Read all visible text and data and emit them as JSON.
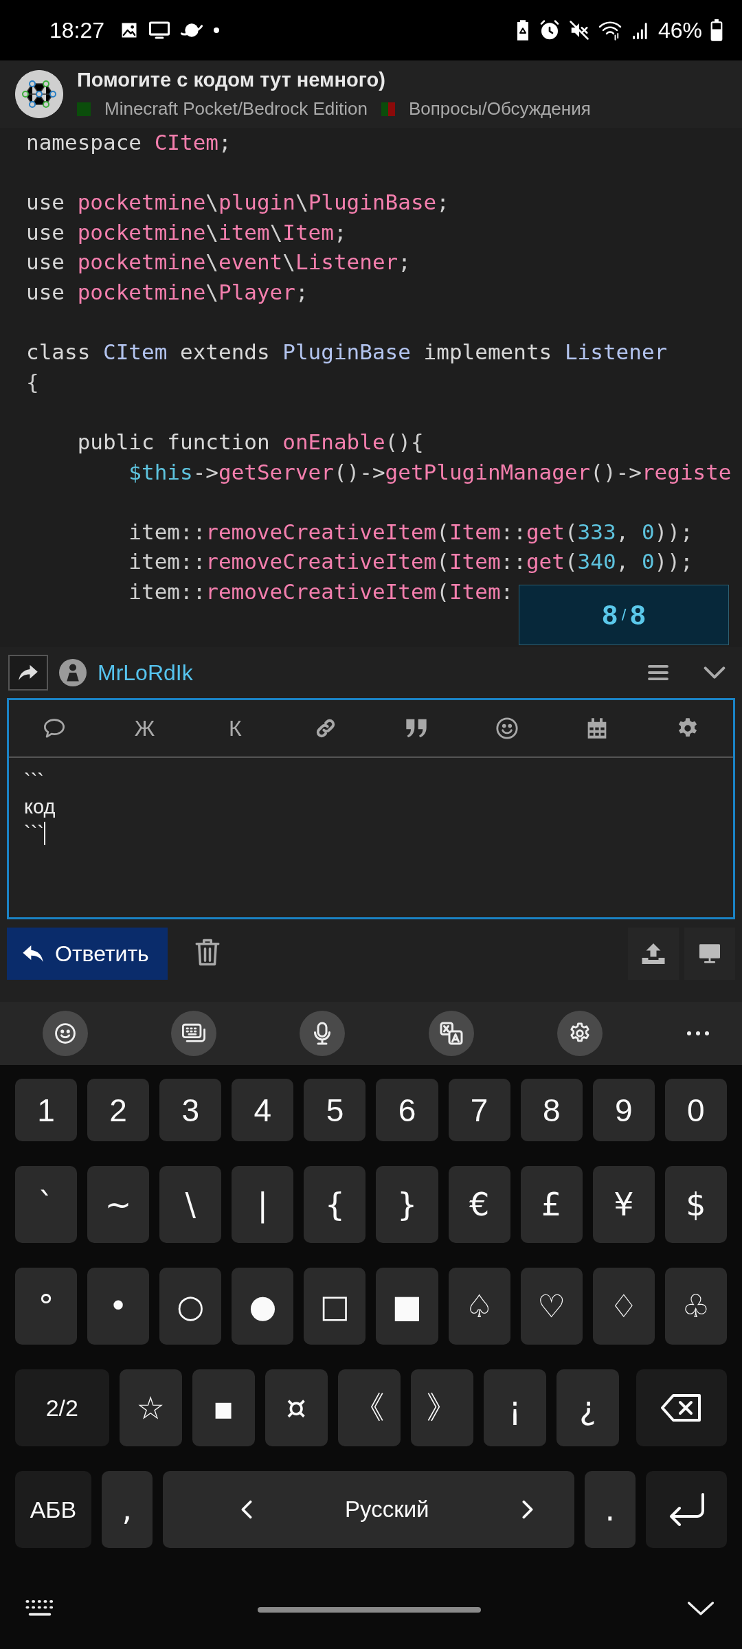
{
  "status_bar": {
    "time": "18:27",
    "battery": "46%"
  },
  "thread": {
    "title": "Помогите с кодом тут немного)",
    "tags": [
      {
        "label": "Minecraft Pocket/Bedrock Edition",
        "swatch": [
          {
            "color": "#0b4d0b"
          }
        ]
      },
      {
        "label": "Вопросы/Обсуждения",
        "swatch": [
          {
            "color": "#0b4d0b"
          },
          {
            "color": "#8b0a0a"
          }
        ]
      }
    ]
  },
  "code": {
    "blocks": [
      [
        [
          {
            "t": "namespace ",
            "kind": "kw"
          },
          {
            "t": "CItem",
            "kind": "fn"
          },
          {
            "t": ";",
            "kind": "plain"
          }
        ]
      ],
      [
        [
          {
            "t": "use ",
            "kind": "kw"
          },
          {
            "t": "pocketmine",
            "kind": "fn"
          },
          {
            "t": "\\",
            "kind": "plain"
          },
          {
            "t": "plugin",
            "kind": "fn"
          },
          {
            "t": "\\",
            "kind": "plain"
          },
          {
            "t": "PluginBase",
            "kind": "fn"
          },
          {
            "t": ";",
            "kind": "plain"
          }
        ],
        [
          {
            "t": "use ",
            "kind": "kw"
          },
          {
            "t": "pocketmine",
            "kind": "fn"
          },
          {
            "t": "\\",
            "kind": "plain"
          },
          {
            "t": "item",
            "kind": "fn"
          },
          {
            "t": "\\",
            "kind": "plain"
          },
          {
            "t": "Item",
            "kind": "fn"
          },
          {
            "t": ";",
            "kind": "plain"
          }
        ],
        [
          {
            "t": "use ",
            "kind": "kw"
          },
          {
            "t": "pocketmine",
            "kind": "fn"
          },
          {
            "t": "\\",
            "kind": "plain"
          },
          {
            "t": "event",
            "kind": "fn"
          },
          {
            "t": "\\",
            "kind": "plain"
          },
          {
            "t": "Listener",
            "kind": "fn"
          },
          {
            "t": ";",
            "kind": "plain"
          }
        ],
        [
          {
            "t": "use ",
            "kind": "kw"
          },
          {
            "t": "pocketmine",
            "kind": "fn"
          },
          {
            "t": "\\",
            "kind": "plain"
          },
          {
            "t": "Player",
            "kind": "fn"
          },
          {
            "t": ";",
            "kind": "plain"
          }
        ]
      ],
      [
        [
          {
            "t": "class ",
            "kind": "kw"
          },
          {
            "t": "CItem",
            "kind": "type"
          },
          {
            "t": " extends ",
            "kind": "kw"
          },
          {
            "t": "PluginBase",
            "kind": "type"
          },
          {
            "t": " implements ",
            "kind": "kw"
          },
          {
            "t": "Listener",
            "kind": "type"
          }
        ],
        [
          {
            "t": "{",
            "kind": "plain"
          }
        ]
      ],
      [
        [
          {
            "t": "    public function ",
            "kind": "kw"
          },
          {
            "t": "onEnable",
            "kind": "fn"
          },
          {
            "t": "(){",
            "kind": "plain"
          }
        ],
        [
          {
            "t": "        $this",
            "kind": "var"
          },
          {
            "t": "->",
            "kind": "plain"
          },
          {
            "t": "getServer",
            "kind": "fn"
          },
          {
            "t": "()->",
            "kind": "plain"
          },
          {
            "t": "getPluginManager",
            "kind": "fn"
          },
          {
            "t": "()->",
            "kind": "plain"
          },
          {
            "t": "registe",
            "kind": "fn"
          }
        ]
      ],
      [
        [
          {
            "t": "        item::",
            "kind": "plain"
          },
          {
            "t": "removeCreativeItem",
            "kind": "fn"
          },
          {
            "t": "(",
            "kind": "plain"
          },
          {
            "t": "Item",
            "kind": "fn"
          },
          {
            "t": "::",
            "kind": "plain"
          },
          {
            "t": "get",
            "kind": "fn"
          },
          {
            "t": "(",
            "kind": "plain"
          },
          {
            "t": "333",
            "kind": "num"
          },
          {
            "t": ", ",
            "kind": "plain"
          },
          {
            "t": "0",
            "kind": "num"
          },
          {
            "t": "));",
            "kind": "plain"
          }
        ],
        [
          {
            "t": "        item::",
            "kind": "plain"
          },
          {
            "t": "removeCreativeItem",
            "kind": "fn"
          },
          {
            "t": "(",
            "kind": "plain"
          },
          {
            "t": "Item",
            "kind": "fn"
          },
          {
            "t": "::",
            "kind": "plain"
          },
          {
            "t": "get",
            "kind": "fn"
          },
          {
            "t": "(",
            "kind": "plain"
          },
          {
            "t": "340",
            "kind": "num"
          },
          {
            "t": ", ",
            "kind": "plain"
          },
          {
            "t": "0",
            "kind": "num"
          },
          {
            "t": "));",
            "kind": "plain"
          }
        ],
        [
          {
            "t": "        item::",
            "kind": "plain"
          },
          {
            "t": "removeCreativeItem",
            "kind": "fn"
          },
          {
            "t": "(",
            "kind": "plain"
          },
          {
            "t": "Item",
            "kind": "fn"
          },
          {
            "t": ":",
            "kind": "plain"
          }
        ]
      ]
    ],
    "counter": {
      "current": "8",
      "separator": "/",
      "total": "8"
    }
  },
  "reply": {
    "username": "MrLoRdIk",
    "toolbar": [
      {
        "kind": "comment"
      },
      {
        "kind": "text",
        "label": "Ж"
      },
      {
        "kind": "text",
        "label": "К"
      },
      {
        "kind": "link"
      },
      {
        "kind": "quote"
      },
      {
        "kind": "smile"
      },
      {
        "kind": "calendar"
      },
      {
        "kind": "gear"
      }
    ],
    "value": "```\nкод\n```",
    "submit": "Ответить"
  },
  "keyboard": {
    "toolbar": [
      {
        "kind": "emoji"
      },
      {
        "kind": "clipboard"
      },
      {
        "kind": "mic"
      },
      {
        "kind": "translate"
      },
      {
        "kind": "settings"
      },
      {
        "kind": "more"
      }
    ],
    "rows": [
      {
        "keys": [
          {
            "kind": "char",
            "label": "1"
          },
          {
            "kind": "char",
            "label": "2"
          },
          {
            "kind": "char",
            "label": "3"
          },
          {
            "kind": "char",
            "label": "4"
          },
          {
            "kind": "char",
            "label": "5"
          },
          {
            "kind": "char",
            "label": "6"
          },
          {
            "kind": "char",
            "label": "7"
          },
          {
            "kind": "char",
            "label": "8"
          },
          {
            "kind": "char",
            "label": "9"
          },
          {
            "kind": "char",
            "label": "0"
          }
        ]
      },
      {
        "keys": [
          {
            "kind": "char",
            "label": "`"
          },
          {
            "kind": "char",
            "label": "~"
          },
          {
            "kind": "char",
            "label": "\\"
          },
          {
            "kind": "char",
            "label": "|"
          },
          {
            "kind": "char",
            "label": "{"
          },
          {
            "kind": "char",
            "label": "}"
          },
          {
            "kind": "char",
            "label": "€"
          },
          {
            "kind": "char",
            "label": "£"
          },
          {
            "kind": "char",
            "label": "¥"
          },
          {
            "kind": "char",
            "label": "$"
          }
        ]
      },
      {
        "keys": [
          {
            "kind": "char",
            "label": "°"
          },
          {
            "kind": "char",
            "label": "•"
          },
          {
            "kind": "char",
            "label": "○"
          },
          {
            "kind": "char",
            "label": "●"
          },
          {
            "kind": "char",
            "label": "□"
          },
          {
            "kind": "char",
            "label": "■"
          },
          {
            "kind": "char",
            "label": "♤"
          },
          {
            "kind": "char",
            "label": "♡"
          },
          {
            "kind": "char",
            "label": "♢"
          },
          {
            "kind": "char",
            "label": "♧"
          }
        ]
      },
      {
        "keys": [
          {
            "kind": "mode",
            "label": "2/2"
          },
          {
            "kind": "char",
            "label": "☆"
          },
          {
            "kind": "char",
            "label": "▪"
          },
          {
            "kind": "char",
            "label": "¤"
          },
          {
            "kind": "char",
            "label": "《"
          },
          {
            "kind": "char",
            "label": "》"
          },
          {
            "kind": "char",
            "label": "¡"
          },
          {
            "kind": "char",
            "label": "¿"
          },
          {
            "kind": "backspace"
          }
        ]
      },
      {
        "keys": [
          {
            "kind": "mode",
            "label": "АБВ"
          },
          {
            "kind": "char",
            "label": ","
          },
          {
            "kind": "space",
            "label": "Русский"
          },
          {
            "kind": "char",
            "label": "."
          },
          {
            "kind": "enter"
          }
        ]
      }
    ]
  }
}
